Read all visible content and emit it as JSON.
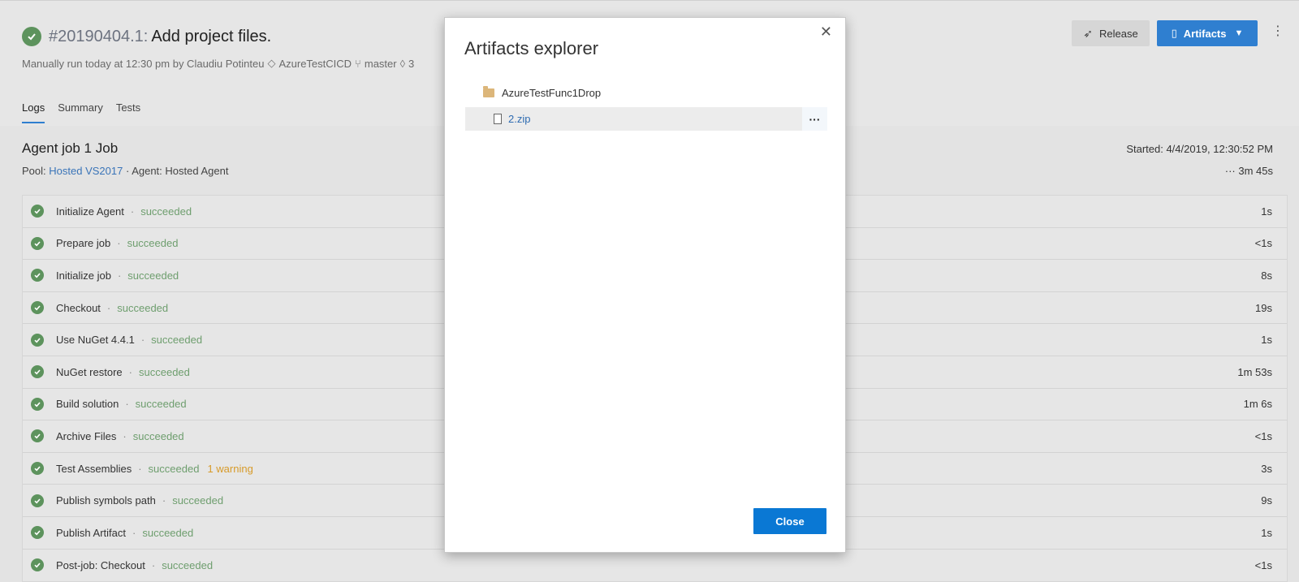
{
  "header": {
    "run_id": "#20190404.1:",
    "run_title": "Add project files.",
    "subline": {
      "run_info": "Manually run today at 12:30 pm by Claudiu Potinteu",
      "repo": "AzureTestCICD",
      "branch": "master",
      "commit": "3"
    },
    "tabs": [
      {
        "label": "Logs",
        "active": true
      },
      {
        "label": "Summary",
        "active": false
      },
      {
        "label": "Tests",
        "active": false
      }
    ],
    "release_label": "Release",
    "artifacts_label": "Artifacts"
  },
  "job": {
    "title": "Agent job 1 Job",
    "pool_label": "Pool:",
    "pool_link": "Hosted VS2017",
    "agent": "· Agent: Hosted Agent",
    "started": "Started: 4/4/2019, 12:30:52 PM",
    "duration_prefix": "···",
    "duration": "3m 45s"
  },
  "steps": [
    {
      "name": "Initialize Agent",
      "status": "succeeded",
      "time": "1s"
    },
    {
      "name": "Prepare job",
      "status": "succeeded",
      "time": "<1s"
    },
    {
      "name": "Initialize job",
      "status": "succeeded",
      "time": "8s"
    },
    {
      "name": "Checkout",
      "status": "succeeded",
      "time": "19s"
    },
    {
      "name": "Use NuGet 4.4.1",
      "status": "succeeded",
      "time": "1s"
    },
    {
      "name": "NuGet restore",
      "status": "succeeded",
      "time": "1m 53s"
    },
    {
      "name": "Build solution",
      "status": "succeeded",
      "time": "1m 6s"
    },
    {
      "name": "Archive Files",
      "status": "succeeded",
      "time": "<1s"
    },
    {
      "name": "Test Assemblies",
      "status": "succeeded",
      "warning": "1 warning",
      "time": "3s"
    },
    {
      "name": "Publish symbols path",
      "status": "succeeded",
      "time": "9s"
    },
    {
      "name": "Publish Artifact",
      "status": "succeeded",
      "time": "1s"
    },
    {
      "name": "Post-job: Checkout",
      "status": "succeeded",
      "time": "<1s"
    }
  ],
  "modal": {
    "title": "Artifacts explorer",
    "folder": "AzureTestFunc1Drop",
    "file": "2.zip",
    "more_label": "···",
    "close_label": "Close"
  },
  "colors": {
    "success": "#5d935d",
    "accent": "#2f7fd0",
    "warning": "#d79b2a"
  }
}
